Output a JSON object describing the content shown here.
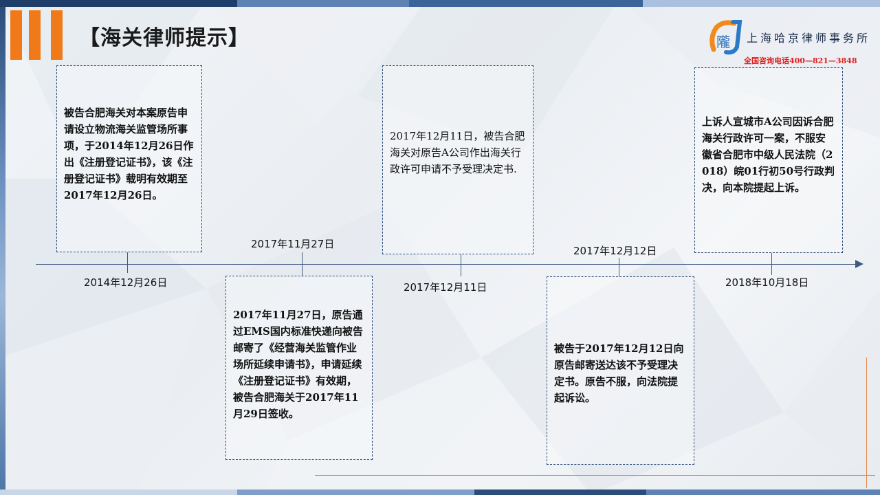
{
  "title": "【海关律师提示】",
  "brand": {
    "logo_char": "隴",
    "firm_name": "上海哈京律师事务所",
    "hotline": "全国咨询电话400—821—3848",
    "colors": {
      "accent_orange": "#f07a1a",
      "hotline_red": "#e02020",
      "navy": "#2c4a78"
    }
  },
  "timeline": {
    "events": [
      {
        "date": "2014年12月26日",
        "text": "被告合肥海关对本案原告申请设立物流海关监管场所事项，于2014年12月26日作出《注册登记证书》，该《注册登记证书》载明有效期至2017年12月26日。"
      },
      {
        "date": "2017年11月27日",
        "text": "2017年11月27日，原告通过EMS国内标准快递向被告邮寄了《经营海关监管作业场所延续申请书》，申请延续《注册登记证书》有效期，被告合肥海关于2017年11月29日签收。"
      },
      {
        "date": "2017年12月11日",
        "text": "2017年12月11日，被告合肥海关对原告A公司作出海关行政许可申请不予受理决定书."
      },
      {
        "date": "2017年12月12日",
        "text": "被告于2017年12月12日向原告邮寄送达该不予受理决定书。原告不服，向法院提起诉讼。"
      },
      {
        "date": "2018年10月18日",
        "text": "上诉人宣城市A公司因诉合肥海关行政许可一案，不服安徽省合肥市中级人民法院（2018）皖01行初50号行政判决，向本院提起上诉。"
      }
    ]
  }
}
